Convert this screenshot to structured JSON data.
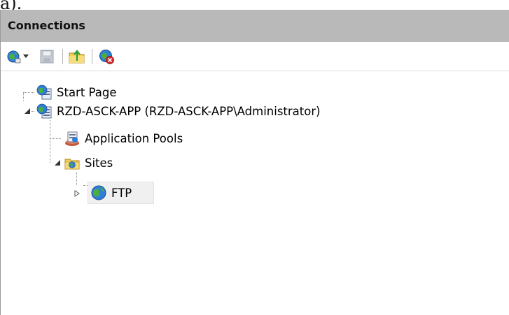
{
  "top_fragment": "a).",
  "panel": {
    "title": "Connections"
  },
  "toolbar": {
    "buttons": [
      {
        "name": "connect-button",
        "icon": "globe-connect-icon"
      },
      {
        "name": "dropdown-arrow",
        "icon": "chevron-down-icon"
      },
      {
        "name": "save-button",
        "icon": "save-icon"
      },
      {
        "name": "up-button",
        "icon": "folder-up-icon"
      },
      {
        "name": "disconnect-button",
        "icon": "globe-disconnect-icon"
      }
    ]
  },
  "tree": {
    "start_page": "Start Page",
    "server": "RZD-ASCK-APP (RZD-ASCK-APP\\Administrator)",
    "app_pools": "Application Pools",
    "sites": "Sites",
    "ftp": "FTP"
  },
  "colors": {
    "header_bg": "#b9b9b9",
    "selection_bg": "#f0f0f0"
  }
}
